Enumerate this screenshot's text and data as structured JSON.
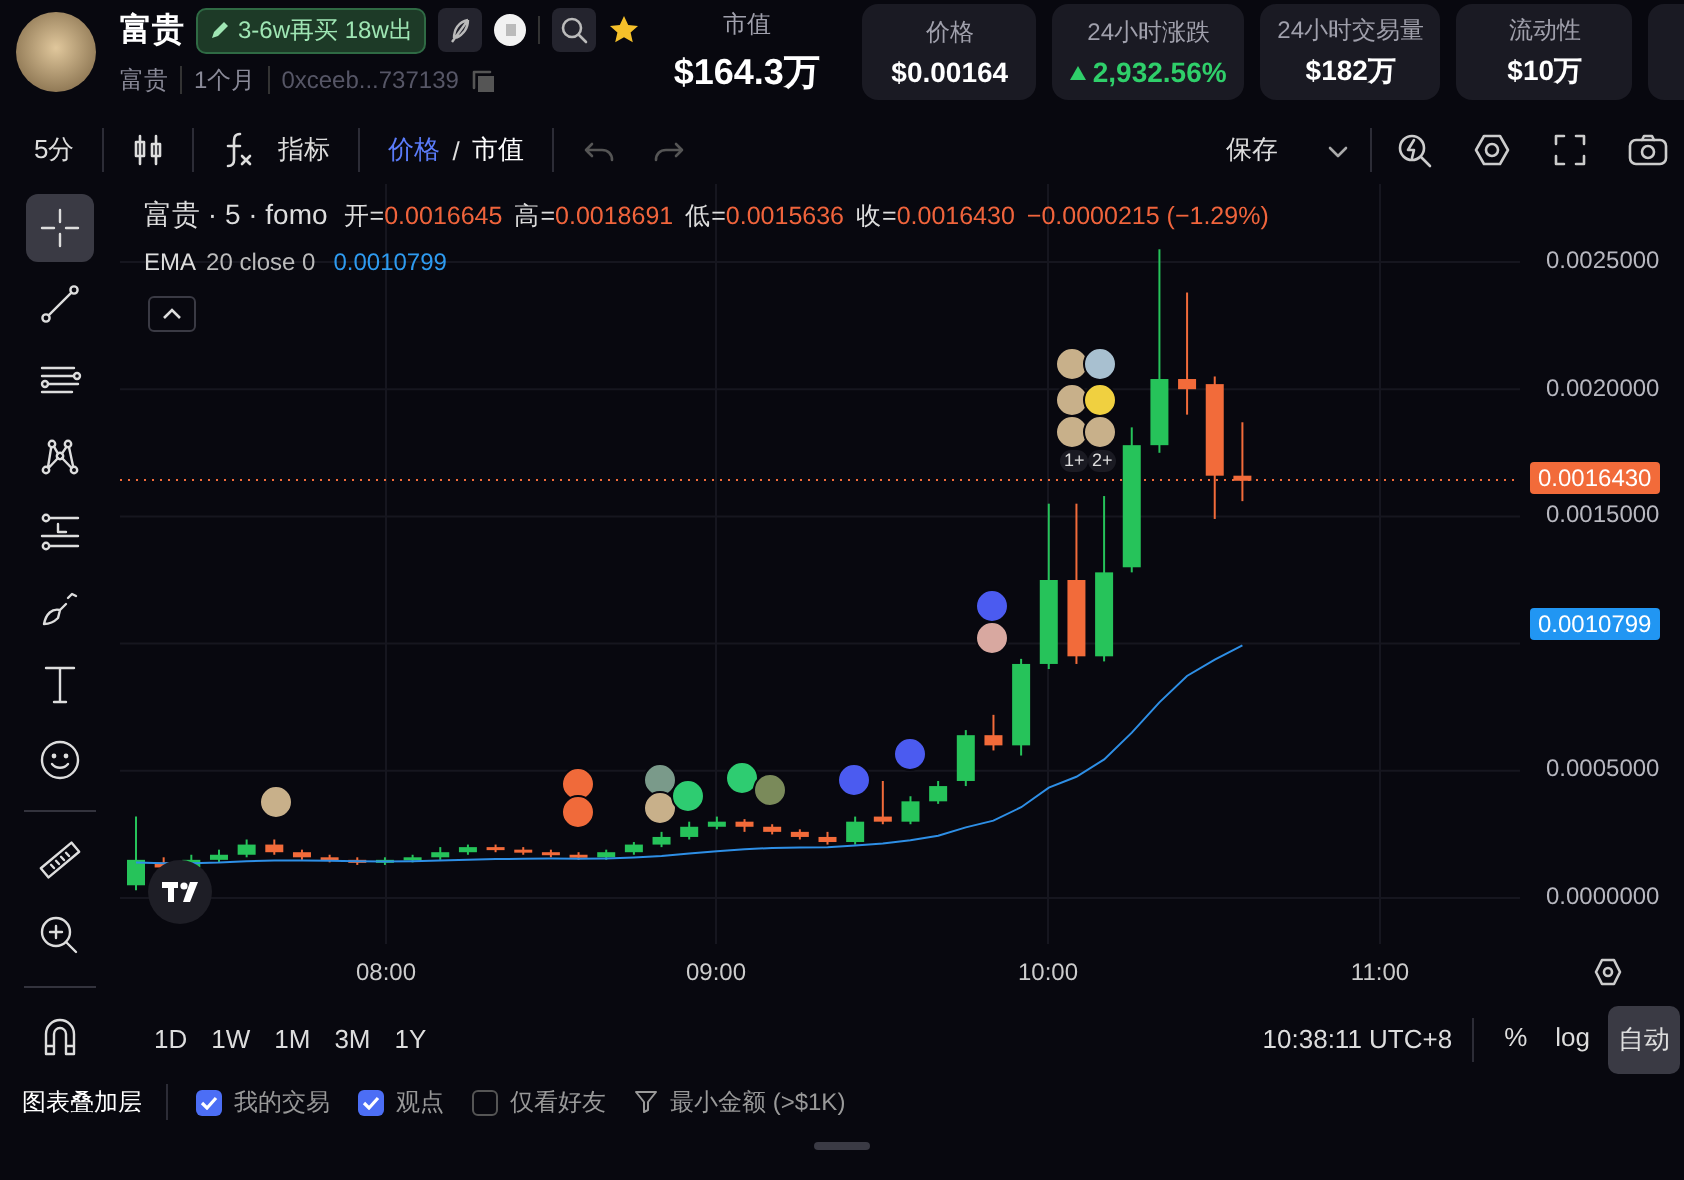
{
  "token": {
    "name": "富贵",
    "tag": "3-6w再买 18w出",
    "symbol": "富贵",
    "age": "1个月",
    "address": "0xceeb...737139",
    "favorite": true
  },
  "stats": [
    {
      "kind": "plain",
      "label": "市值",
      "value": "$164.3万"
    },
    {
      "kind": "card",
      "label": "价格",
      "value": "$0.00164"
    },
    {
      "kind": "card",
      "label": "24小时涨跌",
      "value": "2,932.56%",
      "trend_up": true
    },
    {
      "kind": "card",
      "label": "24小时交易量",
      "value": "$182万"
    },
    {
      "kind": "card",
      "label": "流动性",
      "value": "$10万"
    }
  ],
  "toolbar": {
    "interval": "5分",
    "indicators": "指标",
    "modes": [
      {
        "label": "价格",
        "selected": true
      },
      {
        "label": "市值",
        "selected": false
      }
    ],
    "separator": "/",
    "save": "保存"
  },
  "tool_groups": [
    [
      {
        "kind": "crosshair",
        "selected": true
      },
      {
        "kind": "trend_line",
        "selected": false
      },
      {
        "kind": "fib",
        "selected": false
      },
      {
        "kind": "pattern",
        "selected": false
      },
      {
        "kind": "position",
        "selected": false
      },
      {
        "kind": "brush",
        "selected": false
      },
      {
        "kind": "text",
        "selected": false
      },
      {
        "kind": "emoji",
        "selected": false
      }
    ],
    [
      {
        "kind": "ruler",
        "selected": false
      },
      {
        "kind": "zoom",
        "selected": false
      }
    ],
    [
      {
        "kind": "magnet",
        "selected": false
      }
    ]
  ],
  "chart": {
    "title": "富贵 · 5 · fomo",
    "ohlc": [
      {
        "label": "开=",
        "value": "0.0016645"
      },
      {
        "label": "高=",
        "value": "0.0018691"
      },
      {
        "label": "低=",
        "value": "0.0015636"
      },
      {
        "label": "收=",
        "value": "0.0016430"
      }
    ],
    "change": "−0.0000215 (−1.29%)",
    "ema": {
      "name": "EMA",
      "params": "20 close 0",
      "value": "0.0010799"
    },
    "y_labels": [
      "0.0025000",
      "0.0020000",
      "0.0015000",
      "0.0005000",
      "0.0000000"
    ],
    "x_labels": [
      "08:00",
      "09:00",
      "10:00",
      "11:00"
    ],
    "last_price": "0.0016430",
    "ema_price": "0.0010799",
    "marker_counts": [
      "1+",
      "2+"
    ]
  },
  "ranges": [
    "1D",
    "1W",
    "1M",
    "3M",
    "1Y"
  ],
  "clock": "10:38:11 UTC+8",
  "scales": [
    {
      "label": "%",
      "selected": false
    },
    {
      "label": "log",
      "selected": false
    },
    {
      "label": "自动",
      "selected": true
    }
  ],
  "overlays": {
    "title": "图表叠加层",
    "options": [
      {
        "label": "我的交易",
        "checked": true
      },
      {
        "label": "观点",
        "checked": true
      },
      {
        "label": "仅看好友",
        "checked": false
      }
    ],
    "filter": "最小金额 (>$1K)"
  }
}
